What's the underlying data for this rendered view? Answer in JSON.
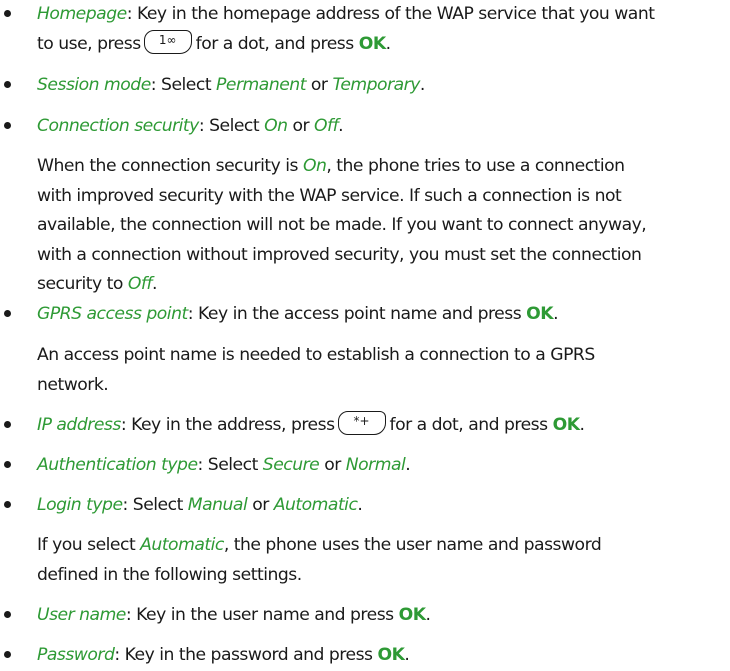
{
  "items": [
    {
      "term": "Homepage",
      "line1": ": Key in the homepage address of the WAP service that you want",
      "line2a": "to use, press",
      "key": "1∞",
      "line2b": "for a dot, and press",
      "ok": "OK",
      "end": "."
    },
    {
      "term": "Session mode",
      "a": ": Select ",
      "opt1": "Permanent",
      "b": " or ",
      "opt2": "Temporary",
      "c": "."
    },
    {
      "term": "Connection security",
      "a": ": Select ",
      "opt1": "On",
      "b": " or ",
      "opt2": "Off",
      "c": "."
    },
    {
      "term": "GPRS access point",
      "a": ": Key in the access point name and press ",
      "ok": "OK",
      "c": "."
    },
    {
      "term": "IP address",
      "a": ": Key in the address, press",
      "key": "*+",
      "b": "for a dot, and press",
      "ok": "OK",
      "c": "."
    },
    {
      "term": "Authentication type",
      "a": ": Select ",
      "opt1": "Secure",
      "b": " or ",
      "opt2": "Normal",
      "c": "."
    },
    {
      "term": "Login type",
      "a": ": Select ",
      "opt1": "Manual",
      "b": " or ",
      "opt2": "Automatic",
      "c": "."
    },
    {
      "term": "User name",
      "a": ": Key in the user name and press ",
      "ok": "OK",
      "c": "."
    },
    {
      "term": "Password",
      "a": ": Key in the password and press ",
      "ok": "OK",
      "c": "."
    }
  ],
  "security_note": {
    "l1a": "When the connection security is ",
    "on": "On",
    "l1b": ", the phone tries to use a connection",
    "l2": "with improved security with the WAP service. If such a connection is not",
    "l3": "available, the connection will not be made. If you want to connect anyway,",
    "l4": "with a connection without improved security, you must set the connection",
    "l5a": "security to ",
    "off": "Off",
    "l5b": "."
  },
  "gprs_note": {
    "l1": "An access point name is needed to establish a connection to a GPRS",
    "l2": "network."
  },
  "login_note": {
    "l1a": "If you select ",
    "auto": "Automatic",
    "l1b": ", the phone uses the user name and password",
    "l2": "defined in the following settings."
  }
}
